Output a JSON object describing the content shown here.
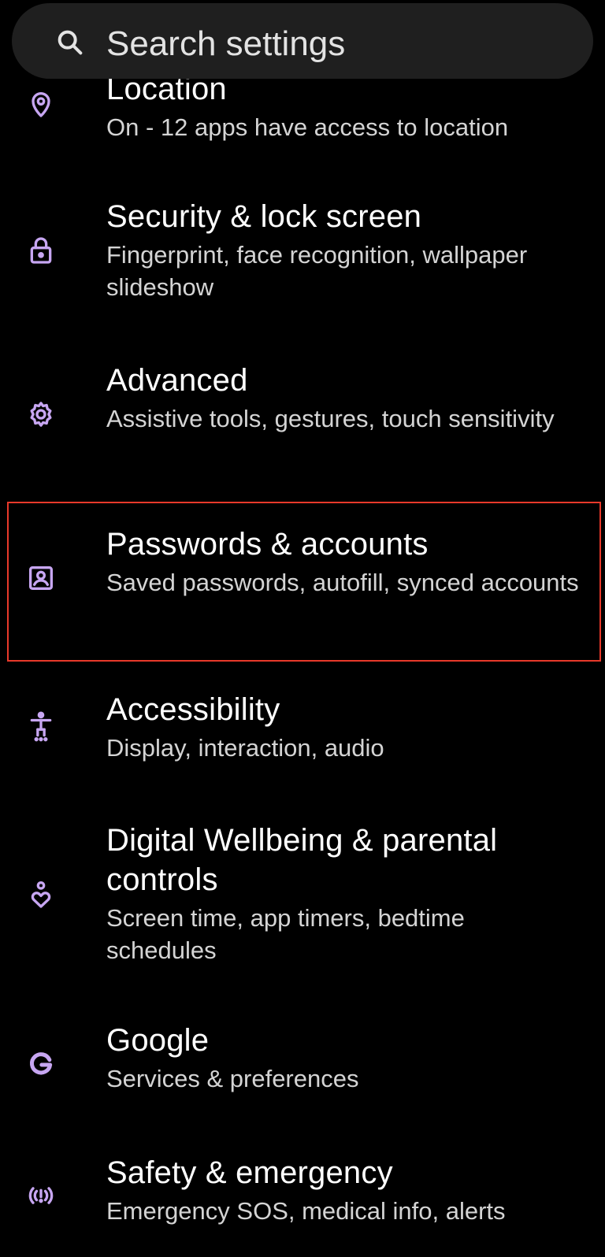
{
  "search": {
    "placeholder": "Search settings",
    "icon": "search-icon"
  },
  "colors": {
    "background": "#000000",
    "icon_accent": "#c7a6f2",
    "highlight_border": "#e8392a",
    "search_bar": "#1f1f1f"
  },
  "settings": [
    {
      "title": "Location",
      "subtitle": "On - 12 apps have access to location",
      "icon": "location-pin-icon"
    },
    {
      "title": "Security & lock screen",
      "subtitle": "Fingerprint, face recognition, wallpaper slideshow",
      "icon": "lock-icon"
    },
    {
      "title": "Advanced",
      "subtitle": "Assistive tools, gestures, touch sensitivity",
      "icon": "gear-icon"
    },
    {
      "title": "Passwords & accounts",
      "subtitle": "Saved passwords, autofill, synced accounts",
      "icon": "account-box-icon"
    },
    {
      "title": "Accessibility",
      "subtitle": "Display, interaction, audio",
      "icon": "accessibility-icon"
    },
    {
      "title": "Digital Wellbeing & parental controls",
      "subtitle": "Screen time, app timers, bedtime schedules",
      "icon": "wellbeing-heart-icon"
    },
    {
      "title": "Google",
      "subtitle": "Services & preferences",
      "icon": "google-g-icon"
    },
    {
      "title": "Safety & emergency",
      "subtitle": "Emergency SOS, medical info, alerts",
      "icon": "emergency-alert-icon"
    }
  ]
}
